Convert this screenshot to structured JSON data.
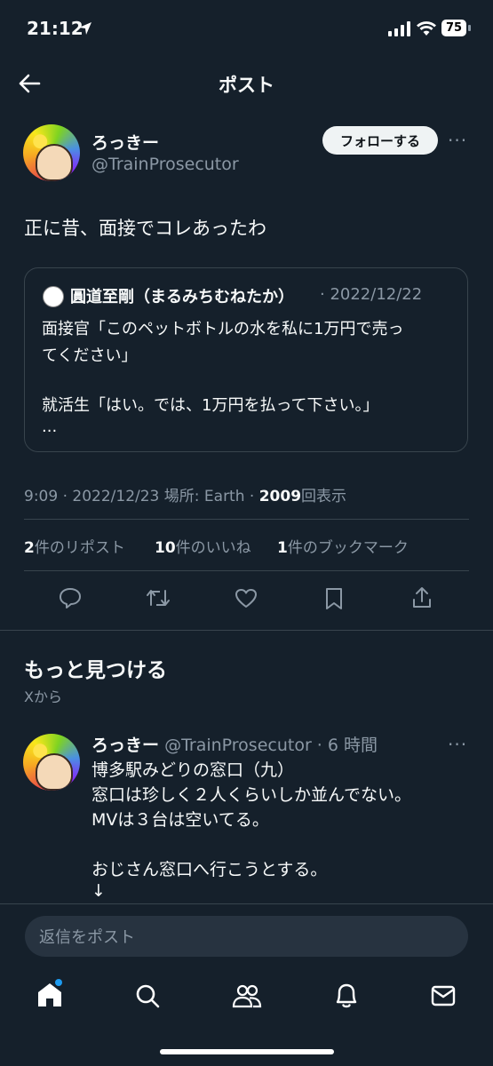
{
  "status_bar": {
    "time": "21:12",
    "battery": "75"
  },
  "header": {
    "title": "ポスト"
  },
  "post": {
    "display_name": "ろっきー",
    "handle": "@TrainProsecutor",
    "follow_label": "フォローする",
    "text": "正に昔、面接でコレあったわ",
    "quote": {
      "name": "圓道至剛（まるみちむねたか）",
      "date": "· 2022/12/22",
      "lines": [
        "面接官「このペットボトルの水を私に1万円で売っ",
        "てください」",
        "",
        "就活生「はい。では、1万円を払って下さい。」",
        "..."
      ]
    },
    "meta": {
      "info": "9:09 · 2022/12/23 場所: Earth · ",
      "views": "2009",
      "views_label": "回表示"
    },
    "stats": [
      {
        "count": "2",
        "label": "件のリポスト"
      },
      {
        "count": "10",
        "label": "件のいいね"
      },
      {
        "count": "1",
        "label": "件のブックマーク"
      }
    ]
  },
  "discover": {
    "title": "もっと見つける",
    "subtitle": "Xから",
    "tweet": {
      "display_name": "ろっきー",
      "handle_time": "@TrainProsecutor · 6 時間",
      "lines": [
        "博多駅みどりの窓口（九）",
        "窓口は珍しく２人くらいしか並んでない。",
        "MVは３台は空いてる。",
        "",
        "おじさん窓口へ行こうとする。",
        "↓"
      ]
    }
  },
  "reply": {
    "placeholder": "返信をポスト"
  },
  "colors": {
    "background": "#15202b",
    "text": "#f7f9f9",
    "muted": "#8b98a5",
    "border": "#38444d",
    "accent": "#1d9bf0"
  }
}
